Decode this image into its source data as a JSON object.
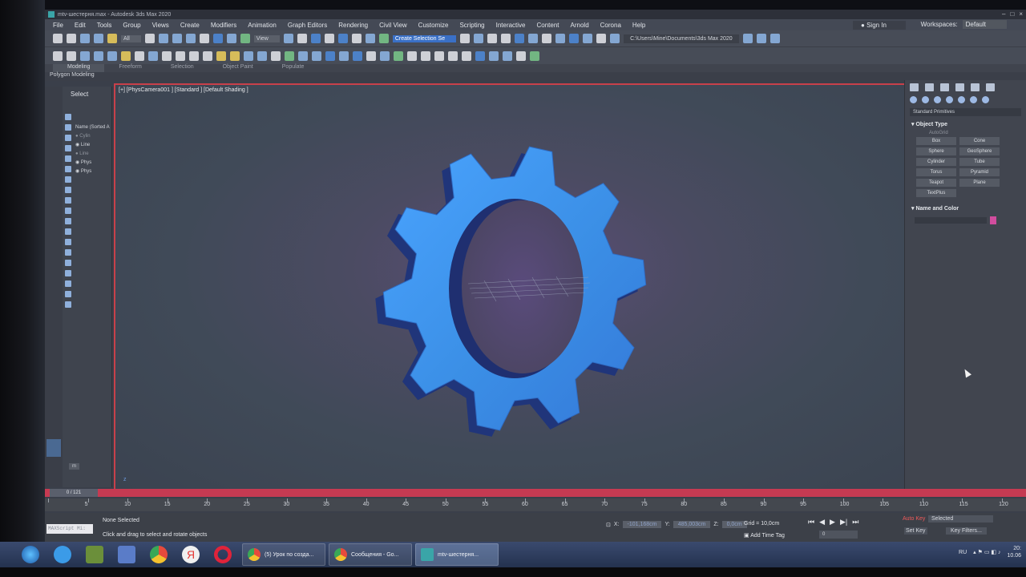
{
  "window": {
    "title": "mtv-шестерня.max - Autodesk 3ds Max 2020",
    "controls": [
      "–",
      "□",
      "×"
    ]
  },
  "menu": [
    "File",
    "Edit",
    "Tools",
    "Group",
    "Views",
    "Create",
    "Modifiers",
    "Animation",
    "Graph Editors",
    "Rendering",
    "Civil View",
    "Customize",
    "Scripting",
    "Interactive",
    "Content",
    "Arnold",
    "Corona",
    "Help"
  ],
  "signin": "Sign In",
  "workspaces": {
    "label": "Workspaces:",
    "value": "Default"
  },
  "toolbar": {
    "filter": "All",
    "view": "View",
    "selection_set": "Create Selection Se",
    "project_path": "C:\\Users\\Mine\\Documents\\3ds Max 2020"
  },
  "ribbon_tabs": [
    {
      "label": "Modeling",
      "active": true
    },
    {
      "label": "Freeform",
      "active": false
    },
    {
      "label": "Selection",
      "active": false
    },
    {
      "label": "Object Paint",
      "active": false
    },
    {
      "label": "Populate",
      "active": false
    }
  ],
  "polygon_modeling": "Polygon Modeling",
  "explorer": {
    "header": "Select",
    "column": "Name (Sorted A",
    "items": [
      "Cylin",
      "Line",
      "Line",
      "Phys",
      "Phys"
    ],
    "layer": "m"
  },
  "viewport": {
    "label": "[+] [PhysCamera001 ] [Standard ] [Default Shading ]",
    "axis": "z"
  },
  "command_panel": {
    "dropdown": "Standard Primitives",
    "object_type_title": "Object Type",
    "autogrid": "AutoGrid",
    "primitives": [
      "Box",
      "Cone",
      "Sphere",
      "GeoSphere",
      "Cylinder",
      "Tube",
      "Torus",
      "Pyramid",
      "Teapot",
      "Plane",
      "TextPlus"
    ],
    "name_color_title": "Name and Color",
    "object_color": "#d14d9e"
  },
  "timeline": {
    "frame_display": "0 / 121",
    "ticks": [
      5,
      10,
      15,
      20,
      25,
      30,
      35,
      40,
      45,
      50,
      55,
      60,
      65,
      70,
      75,
      80,
      85,
      90,
      95,
      100,
      105,
      110,
      115,
      120
    ]
  },
  "status": {
    "script_label": "MAXScript Mi:",
    "selection": "None Selected",
    "hint": "Click and drag to select and rotate objects",
    "x_label": "X:",
    "x_value": "-101,168cm",
    "y_label": "Y:",
    "y_value": "485,003cm",
    "z_label": "Z:",
    "z_value": "0,0cm",
    "grid": "Grid = 10,0cm",
    "add_time_tag": "Add Time Tag",
    "frame_field": "0",
    "auto_key": "Auto Key",
    "set_key": "Set Key",
    "selected": "Selected",
    "key_filters": "Key Filters..."
  },
  "taskbar": {
    "windows": [
      {
        "label": "(5) Урок по созда...",
        "icon_color": "#e64a3c",
        "active": false
      },
      {
        "label": "Сообщения - Go...",
        "icon_color": "#e64a3c",
        "active": false
      },
      {
        "label": "mtv-шестерня...",
        "icon_color": "#3aa5a8",
        "active": true
      }
    ],
    "tray_lang": "RU",
    "time": "20:",
    "date": "10.06"
  },
  "colors": {
    "gear_face": "#3b8fe6",
    "gear_side": "#243a86",
    "accent_red": "#c63a52",
    "selection_blue": "#3a70c6"
  }
}
